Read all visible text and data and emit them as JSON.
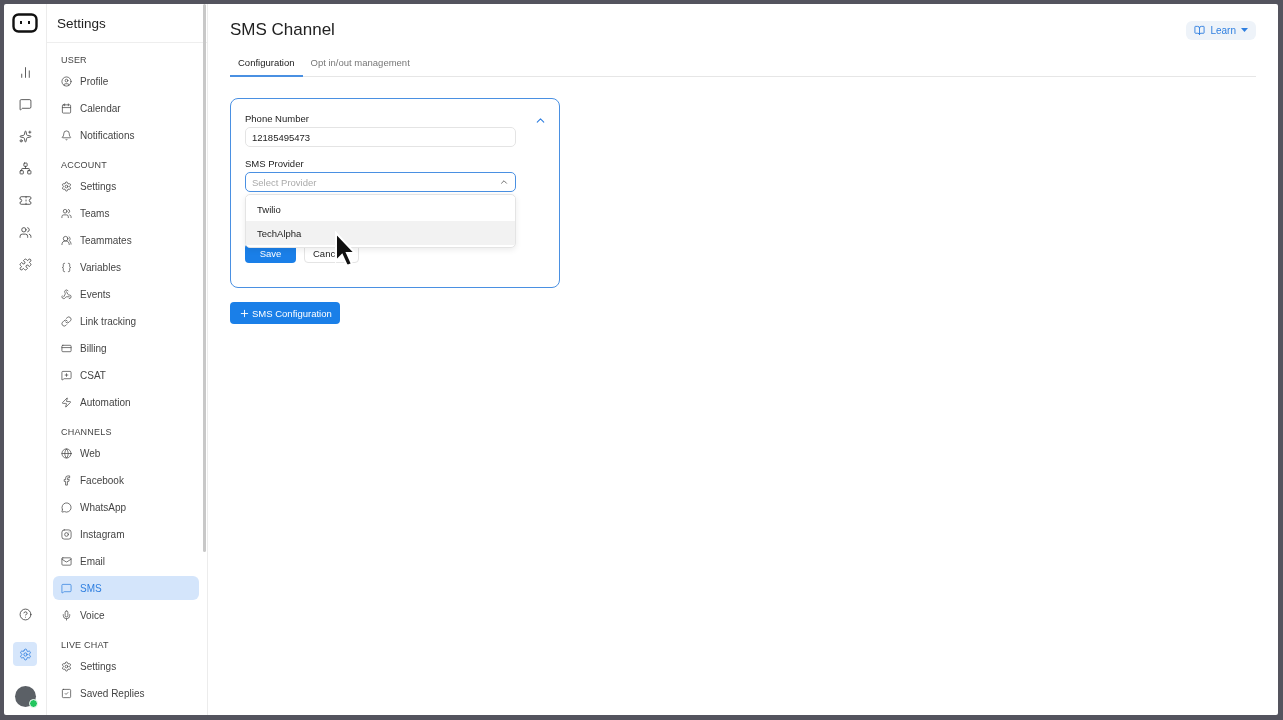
{
  "rail": {
    "items": [
      {
        "selected": false
      },
      {
        "selected": false
      },
      {
        "selected": false
      },
      {
        "selected": false
      },
      {
        "selected": false
      },
      {
        "selected": false
      },
      {
        "selected": false
      }
    ],
    "bottom_items": [
      {
        "selected": false
      },
      {
        "selected": true
      }
    ],
    "avatar": {
      "online": true
    }
  },
  "sidebar": {
    "title": "Settings",
    "sections": [
      {
        "heading": "USER",
        "items": [
          {
            "label": "Profile",
            "selected": false
          },
          {
            "label": "Calendar",
            "selected": false
          },
          {
            "label": "Notifications",
            "selected": false
          }
        ]
      },
      {
        "heading": "ACCOUNT",
        "items": [
          {
            "label": "Settings",
            "selected": false
          },
          {
            "label": "Teams",
            "selected": false
          },
          {
            "label": "Teammates",
            "selected": false
          },
          {
            "label": "Variables",
            "selected": false
          },
          {
            "label": "Events",
            "selected": false
          },
          {
            "label": "Link tracking",
            "selected": false
          },
          {
            "label": "Billing",
            "selected": false
          },
          {
            "label": "CSAT",
            "selected": false
          },
          {
            "label": "Automation",
            "selected": false
          }
        ]
      },
      {
        "heading": "CHANNELS",
        "items": [
          {
            "label": "Web",
            "selected": false
          },
          {
            "label": "Facebook",
            "selected": false
          },
          {
            "label": "WhatsApp",
            "selected": false
          },
          {
            "label": "Instagram",
            "selected": false
          },
          {
            "label": "Email",
            "selected": false
          },
          {
            "label": "SMS",
            "selected": true
          },
          {
            "label": "Voice",
            "selected": false
          }
        ]
      },
      {
        "heading": "LIVE CHAT",
        "items": [
          {
            "label": "Settings",
            "selected": false
          },
          {
            "label": "Saved Replies",
            "selected": false
          }
        ]
      }
    ]
  },
  "main": {
    "title": "SMS Channel",
    "learn_button": "Learn",
    "tabs": [
      {
        "label": "Configuration",
        "selected": true
      },
      {
        "label": "Opt in/out management",
        "selected": false
      }
    ],
    "card": {
      "expanded": true,
      "phone": {
        "label": "Phone Number",
        "value": "12185495473"
      },
      "provider": {
        "label": "SMS Provider",
        "placeholder": "Select Provider",
        "open": true,
        "options": [
          {
            "label": "Twilio",
            "highlighted": false
          },
          {
            "label": "TechAlpha",
            "highlighted": true
          }
        ]
      },
      "save_button": "Save",
      "cancel_button": "Canc"
    },
    "add_button": "SMS Configuration"
  }
}
